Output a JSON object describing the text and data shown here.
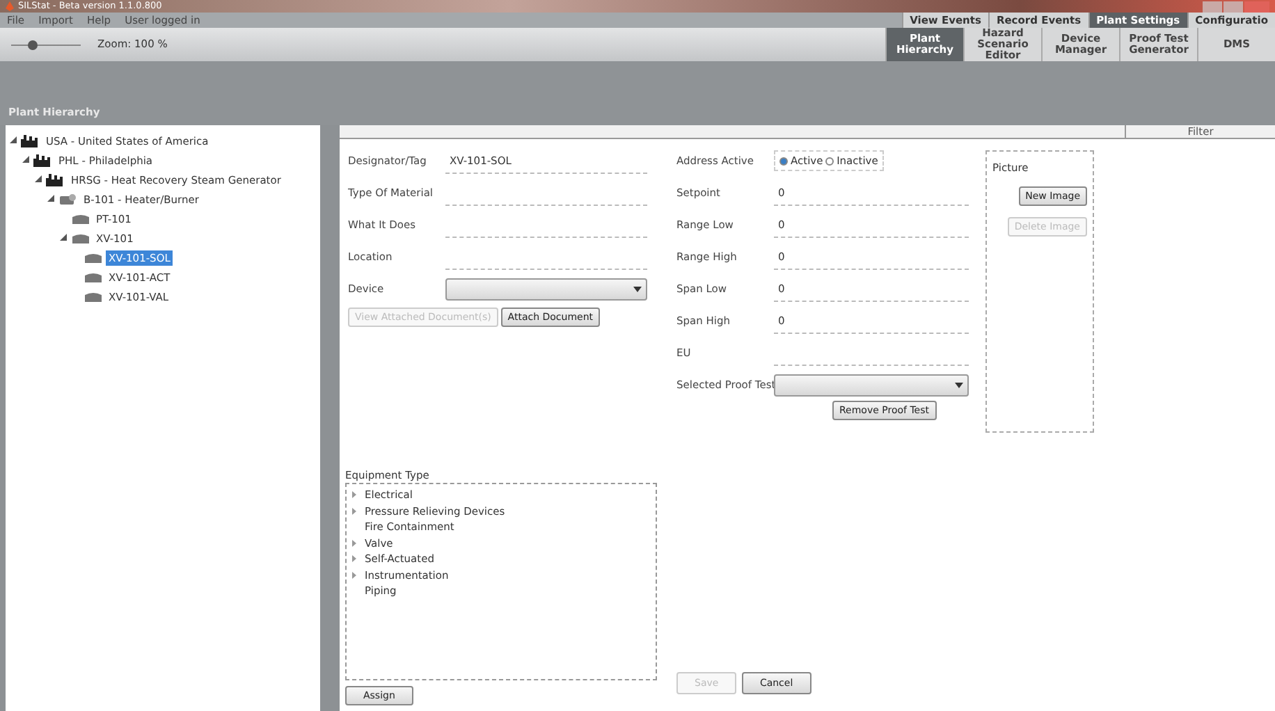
{
  "window": {
    "title": "SILStat - Beta version 1.1.0.800"
  },
  "menu": [
    "File",
    "Import",
    "Help",
    "User logged in"
  ],
  "zoom": {
    "level": 0.3,
    "reading": "Zoom: 100 %"
  },
  "top_tabs": [
    {
      "label": "View Events",
      "selected": false
    },
    {
      "label": "Record Events",
      "selected": false
    },
    {
      "label": "Plant Settings",
      "selected": true
    },
    {
      "label": "Configuratio",
      "selected": false
    }
  ],
  "sub_tabs": [
    {
      "label": "Plant Hierarchy",
      "selected": true
    },
    {
      "label": "Hazard Scenario Editor",
      "selected": false
    },
    {
      "label": "Device Manager",
      "selected": false
    },
    {
      "label": "Proof Test Generator",
      "selected": false
    },
    {
      "label": "DMS",
      "selected": false
    }
  ],
  "panel_title": "Plant Hierarchy",
  "tree": [
    {
      "label": "USA - United States of America",
      "kind": "site",
      "expanded": true,
      "selected": false,
      "children": [
        {
          "label": "PHL - Philadelphia",
          "kind": "site",
          "expanded": true,
          "selected": false,
          "children": [
            {
              "label": "HRSG - Heat Recovery Steam Generator",
              "kind": "site",
              "expanded": true,
              "selected": false,
              "children": [
                {
                  "label": "B-101 - Heater/Burner",
                  "kind": "unit",
                  "expanded": true,
                  "selected": false,
                  "children": [
                    {
                      "label": "PT-101",
                      "kind": "device",
                      "selected": false
                    },
                    {
                      "label": "XV-101",
                      "kind": "device",
                      "expanded": true,
                      "selected": false,
                      "children": [
                        {
                          "label": "XV-101-SOL",
                          "kind": "device",
                          "selected": true
                        },
                        {
                          "label": "XV-101-ACT",
                          "kind": "device",
                          "selected": false
                        },
                        {
                          "label": "XV-101-VAL",
                          "kind": "device",
                          "selected": false
                        }
                      ]
                    }
                  ]
                }
              ]
            }
          ]
        }
      ]
    }
  ],
  "filter": "Filter",
  "left_fields": [
    {
      "label": "Designator/Tag",
      "kind": "text",
      "value": "XV-101-SOL"
    },
    {
      "label": "Type Of Material",
      "kind": "text"
    },
    {
      "label": "What It Does",
      "kind": "text"
    },
    {
      "label": "Location",
      "kind": "text"
    },
    {
      "label": "Device",
      "kind": "dropdown"
    }
  ],
  "document_buttons": [
    {
      "label": "View Attached Document(s)",
      "disabled": true
    },
    {
      "label": "Attach Document",
      "disabled": false
    }
  ],
  "address_active": {
    "label": "Address Active",
    "options": [
      {
        "label": "Active",
        "selected": true
      },
      {
        "label": "Inactive",
        "selected": false
      }
    ]
  },
  "right_fields": [
    {
      "label": "Setpoint",
      "kind": "text",
      "value": "0"
    },
    {
      "label": "Range Low",
      "kind": "text",
      "value": "0"
    },
    {
      "label": "Range High",
      "kind": "text",
      "value": "0"
    },
    {
      "label": "Span Low",
      "kind": "text",
      "value": "0"
    },
    {
      "label": "Span High",
      "kind": "text",
      "value": "0"
    },
    {
      "label": "EU",
      "kind": "text"
    },
    {
      "label": "Selected Proof Test",
      "kind": "dropdown"
    }
  ],
  "remove_button": {
    "label": "Remove Proof Test",
    "disabled": false
  },
  "picture": {
    "label": "Picture",
    "buttons": [
      {
        "label": "New Image",
        "disabled": false
      },
      {
        "label": "Delete Image",
        "disabled": true
      }
    ]
  },
  "equipment_type": {
    "label": "Equipment Type",
    "items": [
      {
        "label": "Electrical",
        "expandable": true
      },
      {
        "label": "Pressure Relieving Devices",
        "expandable": true
      },
      {
        "label": "Fire Containment",
        "expandable": false
      },
      {
        "label": "Valve",
        "expandable": true
      },
      {
        "label": "Self-Actuated",
        "expandable": true
      },
      {
        "label": "Instrumentation",
        "expandable": true
      },
      {
        "label": "Piping",
        "expandable": false
      }
    ]
  },
  "assign_button": {
    "label": "Assign",
    "disabled": false
  },
  "bottom_buttons": [
    {
      "label": "Save",
      "disabled": true
    },
    {
      "label": "Cancel",
      "disabled": false
    }
  ]
}
